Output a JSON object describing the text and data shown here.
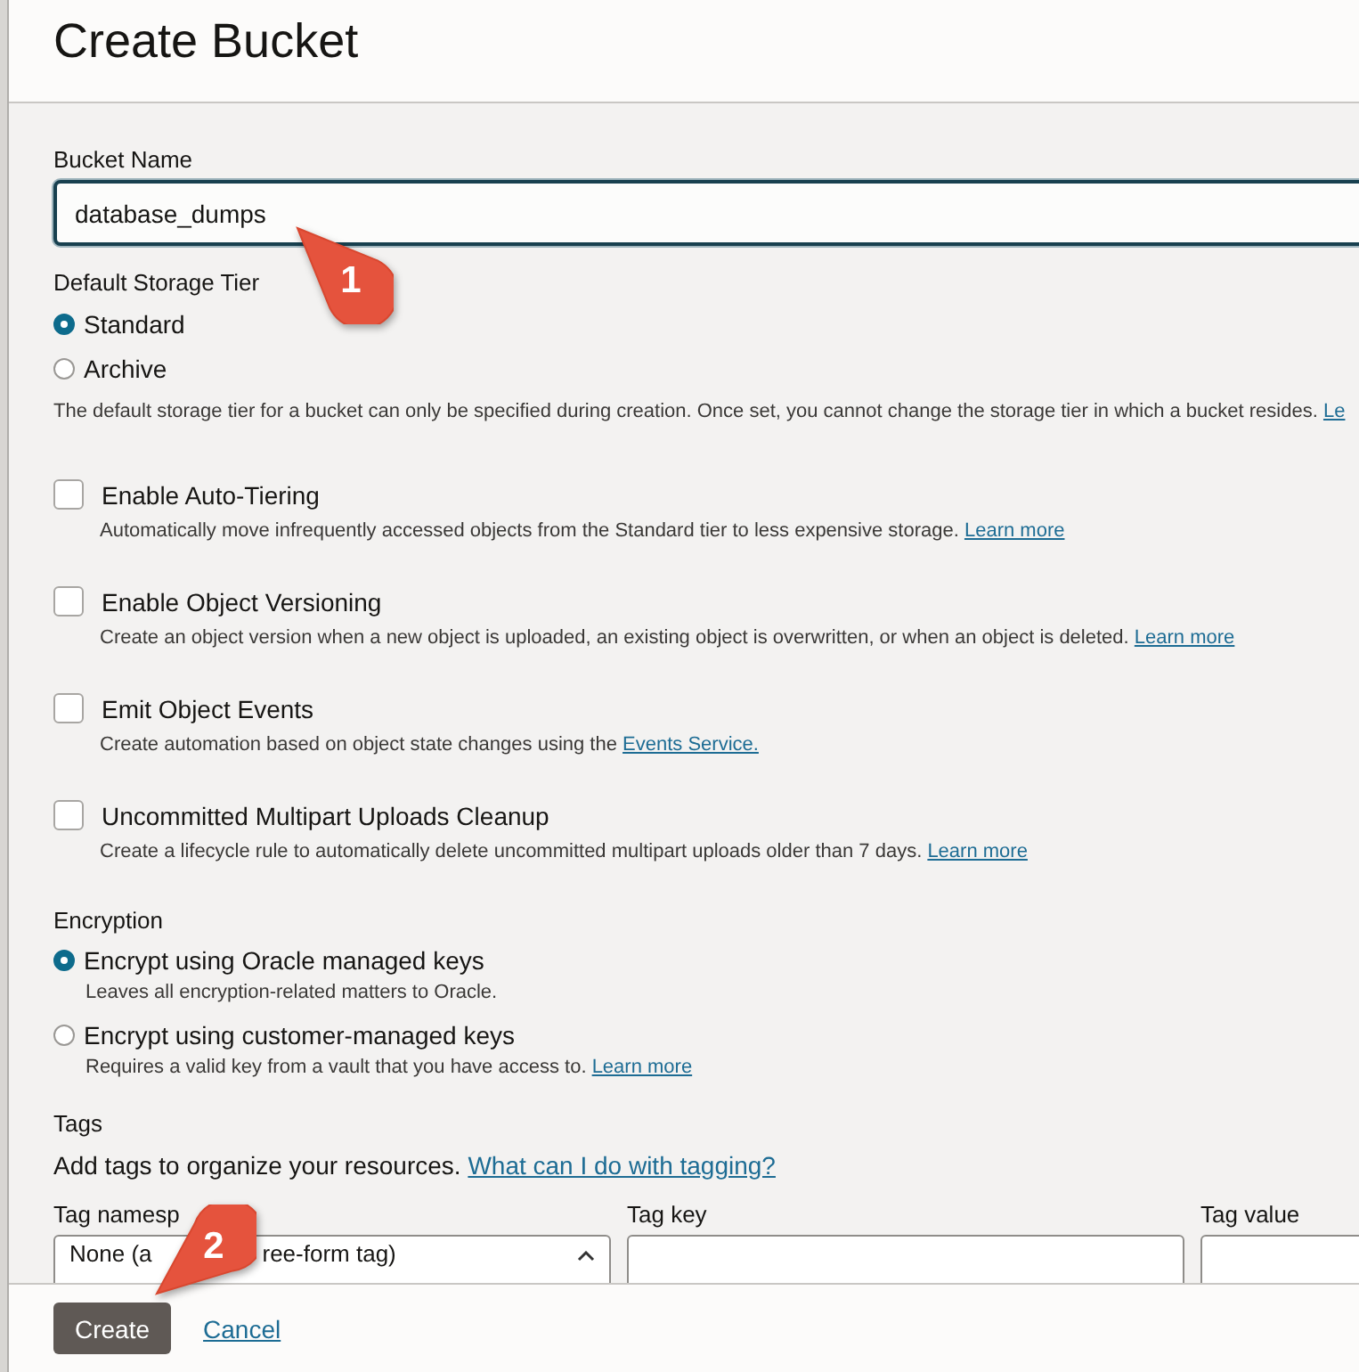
{
  "dialog": {
    "title": "Create Bucket"
  },
  "bucket_name": {
    "label": "Bucket Name",
    "value": "database_dumps"
  },
  "storage_tier": {
    "label": "Default Storage Tier",
    "options": [
      {
        "label": "Standard",
        "selected": true
      },
      {
        "label": "Archive",
        "selected": false
      }
    ],
    "help": "The default storage tier for a bucket can only be specified during creation. Once set, you cannot change the storage tier in which a bucket resides.",
    "link": "Le"
  },
  "options": [
    {
      "label": "Enable Auto-Tiering",
      "checked": false,
      "description": "Automatically move infrequently accessed objects from the Standard tier to less expensive storage.",
      "link": "Learn more"
    },
    {
      "label": "Enable Object Versioning",
      "checked": false,
      "description": "Create an object version when a new object is uploaded, an existing object is overwritten, or when an object is deleted.",
      "link": "Learn more"
    },
    {
      "label": "Emit Object Events",
      "checked": false,
      "description": "Create automation based on object state changes using the",
      "link": "Events Service."
    },
    {
      "label": "Uncommitted Multipart Uploads Cleanup",
      "checked": false,
      "description": "Create a lifecycle rule to automatically delete uncommitted multipart uploads older than 7 days.",
      "link": "Learn more"
    }
  ],
  "encryption": {
    "label": "Encryption",
    "options": [
      {
        "label": "Encrypt using Oracle managed keys",
        "selected": true,
        "description": "Leaves all encryption-related matters to Oracle."
      },
      {
        "label": "Encrypt using customer-managed keys",
        "selected": false,
        "description": "Requires a valid key from a vault that you have access to.",
        "link": "Learn more"
      }
    ]
  },
  "tags": {
    "label": "Tags",
    "intro": "Add tags to organize your resources.",
    "link": "What can I do with tagging?",
    "columns": [
      {
        "label": "Tag namesp",
        "kind": "select",
        "value_parts": [
          "None (a",
          "ree-form tag)"
        ]
      },
      {
        "label": "Tag key",
        "kind": "text"
      },
      {
        "label": "Tag value",
        "kind": "text"
      }
    ]
  },
  "footer": {
    "buttons": [
      {
        "label": "Create",
        "kind": "primary"
      },
      {
        "label": "Cancel",
        "kind": "link"
      }
    ]
  },
  "callouts": [
    {
      "number": "1"
    },
    {
      "number": "2"
    }
  ]
}
